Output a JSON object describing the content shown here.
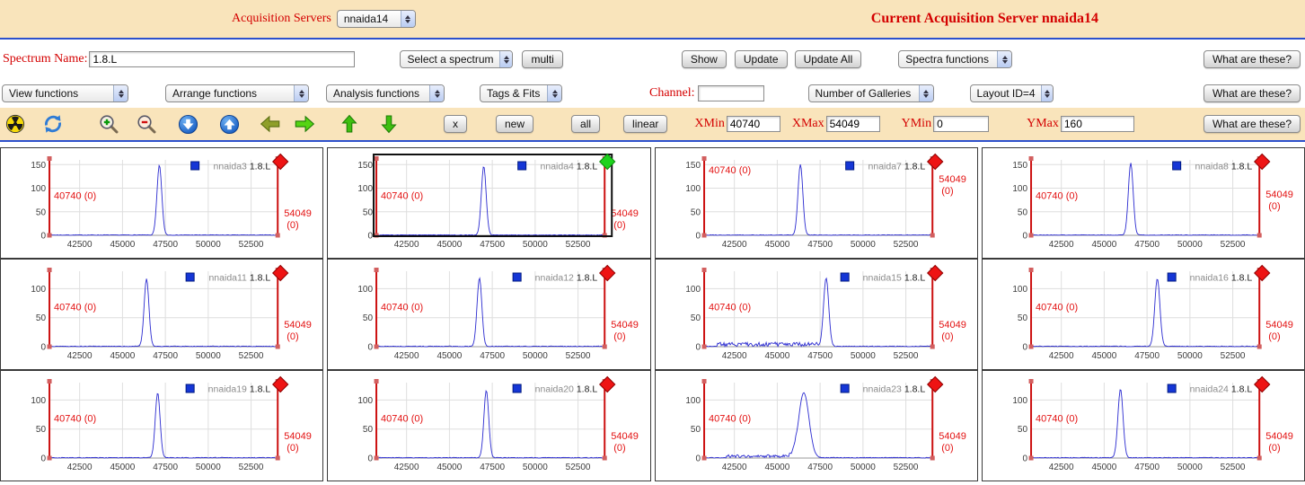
{
  "header": {
    "acquisition_servers_label": "Acquisition Servers",
    "server_select_value": "nnaida14",
    "current_server_label": "Current Acquisition Server nnaida14"
  },
  "spectrum_bar": {
    "spectrum_name_label": "Spectrum Name:",
    "spectrum_name_value": "1.8.L",
    "spectrum_select_value": "Select a spectrum",
    "multi_button": "multi",
    "show_button": "Show",
    "update_button": "Update",
    "update_all_button": "Update All",
    "spectra_functions_select": "Spectra functions",
    "help_button": "What are these?"
  },
  "functions_bar": {
    "view_functions_select": "View functions",
    "arrange_functions_select": "Arrange functions",
    "analysis_functions_select": "Analysis functions",
    "tags_fits_select": "Tags & Fits",
    "channel_label": "Channel:",
    "channel_value": "",
    "galleries_select": "Number of Galleries",
    "layout_select": "Layout ID=4",
    "help_button": "What are these?"
  },
  "toolbar": {
    "x_button": "x",
    "new_button": "new",
    "all_button": "all",
    "linear_button": "linear",
    "xmin_label": "XMin",
    "xmin_value": "40740",
    "xmax_label": "XMax",
    "xmax_value": "54049",
    "ymin_label": "YMin",
    "ymin_value": "0",
    "ymax_label": "YMax",
    "ymax_value": "160",
    "help_button": "What are these?",
    "icons": [
      "radiation-icon",
      "refresh-icon",
      "zoom-in-icon",
      "zoom-out-icon",
      "scroll-down-icon",
      "scroll-up-icon",
      "arrow-left-icon",
      "arrow-right-icon",
      "arrow-up-icon",
      "arrow-down-icon"
    ]
  },
  "chart_data": {
    "type": "line",
    "x_range": [
      40740,
      54049
    ],
    "x_ticks": [
      42500,
      45000,
      47500,
      50000,
      52500
    ],
    "line_color": "#2b2bd0",
    "marker_color": "#cc1111",
    "left_marker_label": "40740 (0)",
    "right_marker_label_line1": "54049",
    "right_marker_label_line2": "(0)",
    "grid": true,
    "plots": [
      {
        "name": "nnaida3",
        "suffix": "1.8.L",
        "y_ticks": [
          0,
          50,
          100,
          150
        ],
        "y_max": 160,
        "peak_x": 47150,
        "peak_h": 148,
        "sigma": 140,
        "diamond": "red",
        "selected": false
      },
      {
        "name": "nnaida4",
        "suffix": "1.8.L",
        "y_ticks": [
          0,
          50,
          100,
          150
        ],
        "y_max": 160,
        "peak_x": 47000,
        "peak_h": 146,
        "sigma": 140,
        "diamond": "green",
        "selected": true
      },
      {
        "name": "nnaida7",
        "suffix": "1.8.L",
        "y_ticks": [
          0,
          50,
          100,
          150
        ],
        "y_max": 160,
        "peak_x": 46350,
        "peak_h": 150,
        "sigma": 140,
        "diamond": "red",
        "selected": false,
        "left_frac": 0.18,
        "right_frac": 0.3
      },
      {
        "name": "nnaida8",
        "suffix": "1.8.L",
        "y_ticks": [
          0,
          50,
          100,
          150
        ],
        "y_max": 160,
        "peak_x": 46550,
        "peak_h": 153,
        "sigma": 140,
        "diamond": "red",
        "selected": false,
        "right_frac": 0.5
      },
      {
        "name": "nnaida11",
        "suffix": "1.8.L",
        "y_ticks": [
          0,
          50,
          100
        ],
        "y_max": 130,
        "peak_x": 46400,
        "peak_h": 116,
        "sigma": 140,
        "diamond": "red",
        "selected": false
      },
      {
        "name": "nnaida12",
        "suffix": "1.8.L",
        "y_ticks": [
          0,
          50,
          100
        ],
        "y_max": 130,
        "peak_x": 46750,
        "peak_h": 118,
        "sigma": 140,
        "diamond": "red",
        "selected": false
      },
      {
        "name": "nnaida15",
        "suffix": "1.8.L",
        "y_ticks": [
          0,
          50,
          100
        ],
        "y_max": 130,
        "peak_x": 47850,
        "peak_h": 118,
        "sigma": 150,
        "diamond": "red",
        "selected": false,
        "noise": [
          41500,
          47400,
          7
        ]
      },
      {
        "name": "nnaida16",
        "suffix": "1.8.L",
        "y_ticks": [
          0,
          50,
          100
        ],
        "y_max": 130,
        "peak_x": 48100,
        "peak_h": 117,
        "sigma": 150,
        "diamond": "red",
        "selected": false
      },
      {
        "name": "nnaida19",
        "suffix": "1.8.L",
        "y_ticks": [
          0,
          50,
          100
        ],
        "y_max": 130,
        "peak_x": 47050,
        "peak_h": 112,
        "sigma": 140,
        "diamond": "red",
        "selected": false
      },
      {
        "name": "nnaida20",
        "suffix": "1.8.L",
        "y_ticks": [
          0,
          50,
          100
        ],
        "y_max": 130,
        "peak_x": 47150,
        "peak_h": 116,
        "sigma": 140,
        "diamond": "red",
        "selected": false
      },
      {
        "name": "nnaida23",
        "suffix": "1.8.L",
        "y_ticks": [
          0,
          50,
          100
        ],
        "y_max": 130,
        "peak_x": 46550,
        "peak_h": 112,
        "sigma": 300,
        "diamond": "red",
        "selected": false,
        "noise": [
          42000,
          46200,
          5
        ]
      },
      {
        "name": "nnaida24",
        "suffix": "1.8.L",
        "y_ticks": [
          0,
          50,
          100
        ],
        "y_max": 130,
        "peak_x": 45950,
        "peak_h": 118,
        "sigma": 150,
        "diamond": "red",
        "selected": false
      }
    ]
  }
}
